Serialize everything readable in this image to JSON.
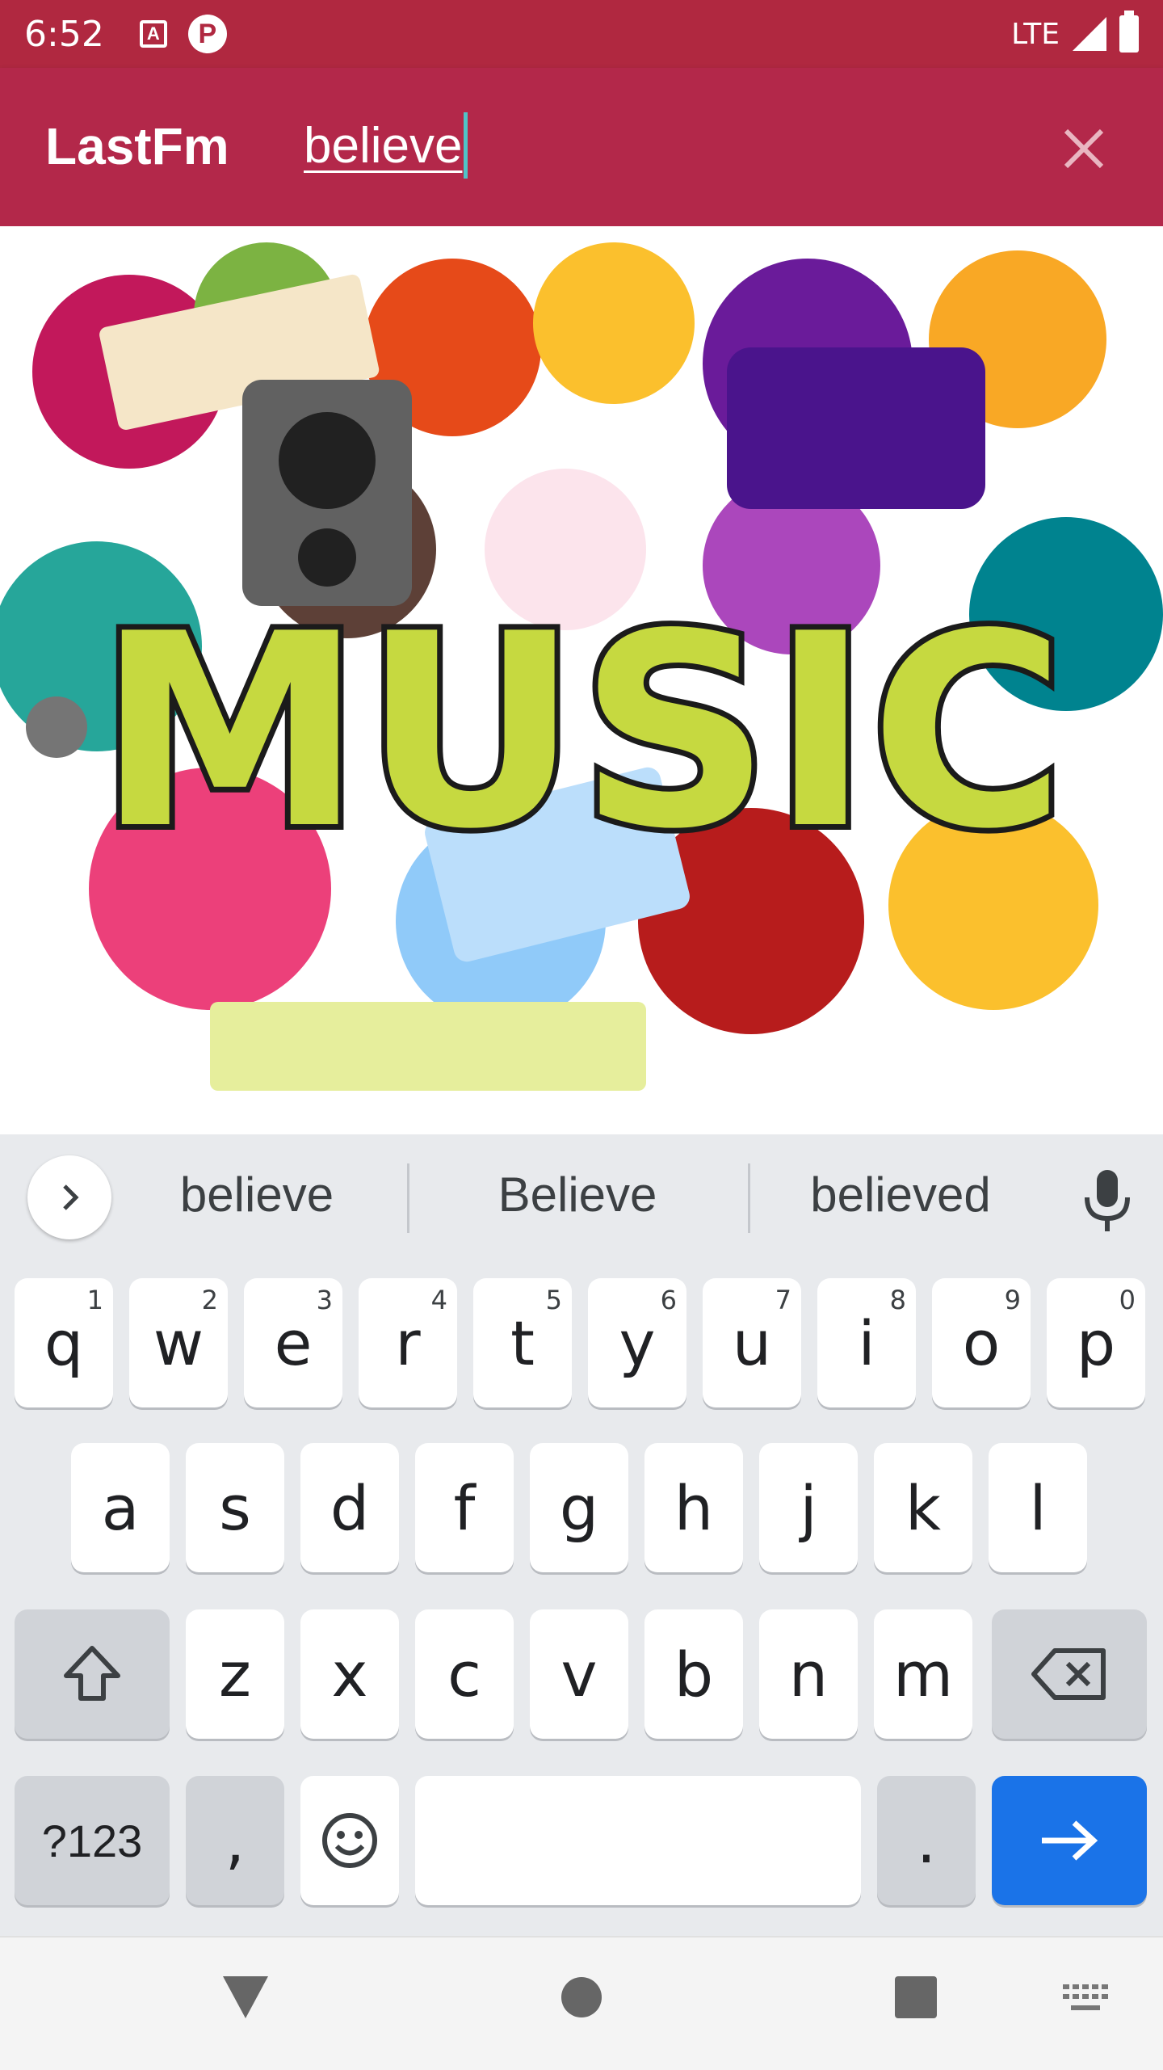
{
  "status_bar": {
    "time": "6:52",
    "network": "LTE",
    "icon_a": "A",
    "icon_p": "P"
  },
  "app_bar": {
    "title": "LastFm",
    "search_value": "believe"
  },
  "hero_image": {
    "caption_art": "MUSIC"
  },
  "keyboard": {
    "suggestions": [
      "believe",
      "Believe",
      "believed"
    ],
    "row1": [
      {
        "key": "q",
        "hint": "1"
      },
      {
        "key": "w",
        "hint": "2"
      },
      {
        "key": "e",
        "hint": "3"
      },
      {
        "key": "r",
        "hint": "4"
      },
      {
        "key": "t",
        "hint": "5"
      },
      {
        "key": "y",
        "hint": "6"
      },
      {
        "key": "u",
        "hint": "7"
      },
      {
        "key": "i",
        "hint": "8"
      },
      {
        "key": "o",
        "hint": "9"
      },
      {
        "key": "p",
        "hint": "0"
      }
    ],
    "row2": [
      "a",
      "s",
      "d",
      "f",
      "g",
      "h",
      "j",
      "k",
      "l"
    ],
    "row3": [
      "z",
      "x",
      "c",
      "v",
      "b",
      "n",
      "m"
    ],
    "symbols_label": "?123",
    "comma": ",",
    "period": "."
  },
  "colors": {
    "primary": "#b3284a",
    "status": "#b02840",
    "accent": "#1a73e8",
    "cursor": "#4fc3c8"
  }
}
